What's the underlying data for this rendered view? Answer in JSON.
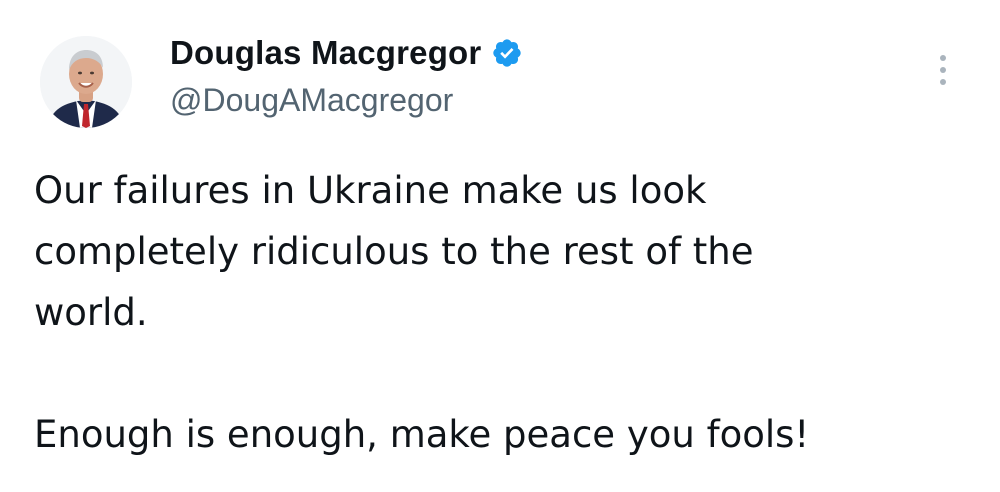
{
  "author": {
    "display_name": "Douglas Macgregor",
    "handle": "@DougAMacgregor",
    "verified": true
  },
  "tweet": {
    "paragraphs": [
      "Our failures in Ukraine make us look\ncompletely ridiculous to the rest of the\nworld.",
      "Enough is enough, make peace you fools!"
    ]
  },
  "icons": {
    "verified": "verified-badge-icon",
    "more": "more-options-icon"
  },
  "colors": {
    "verified_blue": "#1d9bf0",
    "text_primary": "#0f1419",
    "text_secondary": "#536471"
  }
}
